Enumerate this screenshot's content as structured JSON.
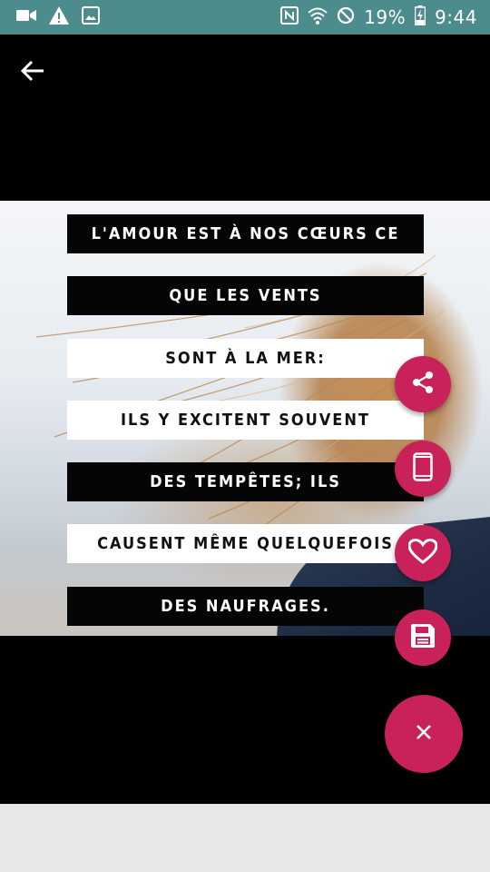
{
  "status_bar": {
    "battery_percent": "19%",
    "time": "9:44",
    "icons": [
      "video-camera-icon",
      "warning-icon",
      "image-icon",
      "nfc-icon",
      "wifi-icon",
      "do-not-disturb-icon",
      "battery-charging-icon"
    ]
  },
  "toolbar": {
    "back_icon": "arrow-back-icon"
  },
  "quote": {
    "lines": [
      {
        "text": "L'AMOUR EST À NOS CŒURS CE",
        "style": "dark"
      },
      {
        "text": "QUE LES VENTS",
        "style": "dark"
      },
      {
        "text": "SONT À LA MER:",
        "style": "light"
      },
      {
        "text": "ILS Y EXCITENT SOUVENT",
        "style": "light"
      },
      {
        "text": "DES TEMPÊTES; ILS",
        "style": "dark"
      },
      {
        "text": "CAUSENT MÊME QUELQUEFOIS",
        "style": "light"
      },
      {
        "text": "DES NAUFRAGES.",
        "style": "dark"
      }
    ]
  },
  "fab_menu": {
    "accent_color": "#c9215a",
    "actions": [
      "share-icon",
      "phone-icon",
      "heart-icon",
      "save-icon"
    ],
    "main_icon": "close-icon"
  }
}
